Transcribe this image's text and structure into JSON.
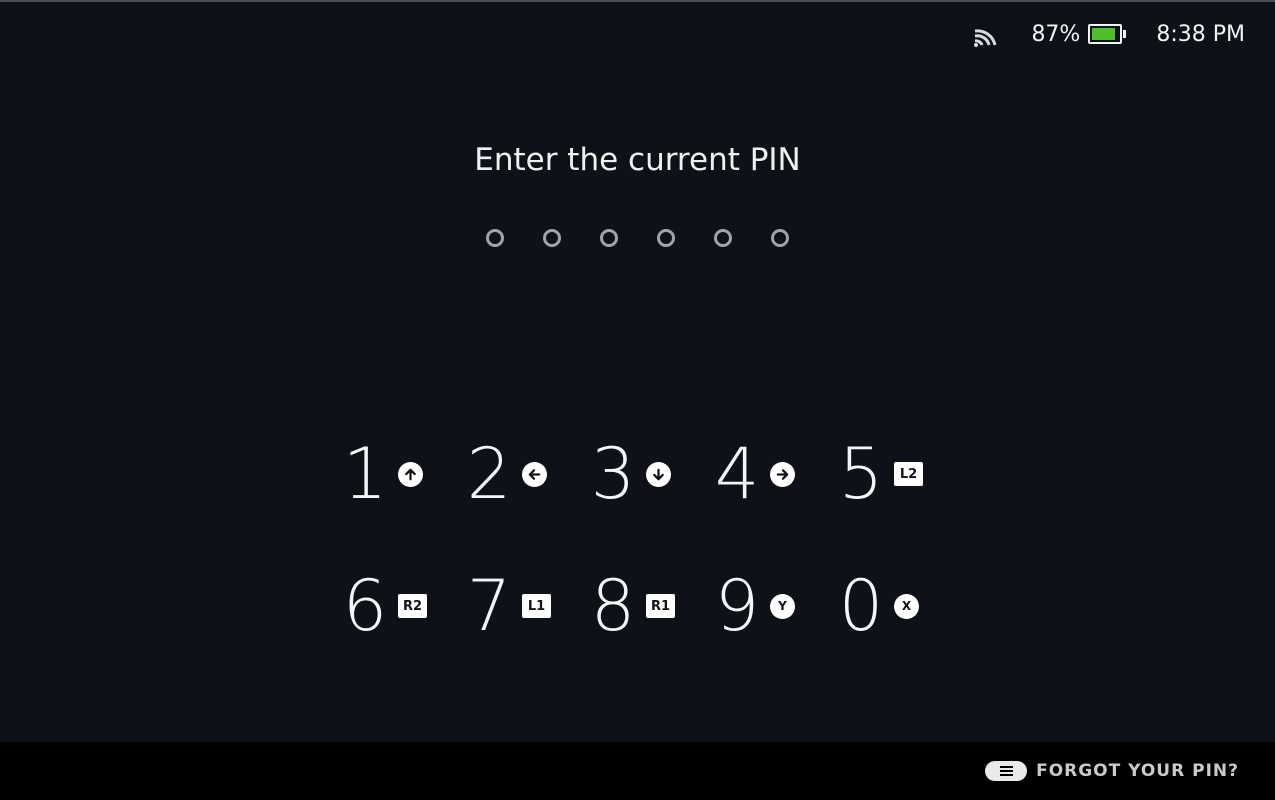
{
  "status_bar": {
    "wifi_icon": "wifi-icon",
    "battery_percent": "87%",
    "battery_level": 0.87,
    "battery_color": "#4cc02a",
    "battery_icon": "battery-icon",
    "time": "8:38 PM"
  },
  "prompt": {
    "title": "Enter the current PIN",
    "pin_length": 6,
    "entered": 0
  },
  "keypad": {
    "row1": [
      {
        "digit": "1",
        "button": "dpad-up",
        "button_icon": "arrow-up-icon"
      },
      {
        "digit": "2",
        "button": "dpad-left",
        "button_icon": "arrow-left-icon"
      },
      {
        "digit": "3",
        "button": "dpad-down",
        "button_icon": "arrow-down-icon"
      },
      {
        "digit": "4",
        "button": "dpad-right",
        "button_icon": "arrow-right-icon"
      },
      {
        "digit": "5",
        "button_label": "L2"
      }
    ],
    "row2": [
      {
        "digit": "6",
        "button_label": "R2"
      },
      {
        "digit": "7",
        "button_label": "L1"
      },
      {
        "digit": "8",
        "button_label": "R1"
      },
      {
        "digit": "9",
        "button_label": "Y"
      },
      {
        "digit": "0",
        "button_label": "X"
      }
    ]
  },
  "footer": {
    "forgot_icon": "menu-button-icon",
    "forgot_label": "FORGOT YOUR PIN?"
  }
}
